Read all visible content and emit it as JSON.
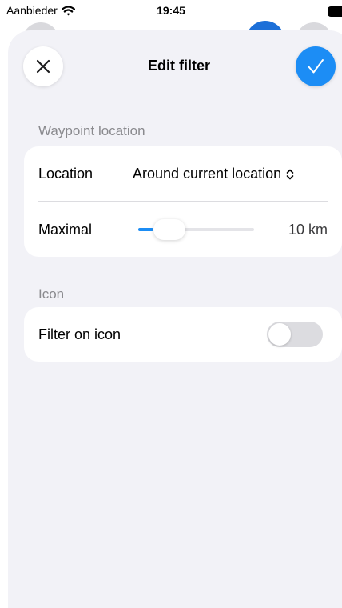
{
  "status_bar": {
    "carrier": "Aanbieder",
    "time": "19:45"
  },
  "header": {
    "title": "Edit filter",
    "close_icon": "close-icon",
    "confirm_icon": "checkmark-icon"
  },
  "sections": {
    "waypoint_location": {
      "header": "Waypoint location",
      "location_label": "Location",
      "location_value": "Around current location",
      "maximal_label": "Maximal",
      "maximal_value": "10 km",
      "slider_level": 0.1
    },
    "icon": {
      "header": "Icon",
      "filter_label": "Filter on icon",
      "filter_enabled": false
    }
  },
  "colors": {
    "accent": "#1c8df5",
    "background": "#f2f2f7",
    "card": "#ffffff",
    "secondary_text": "#8a8a8e"
  }
}
